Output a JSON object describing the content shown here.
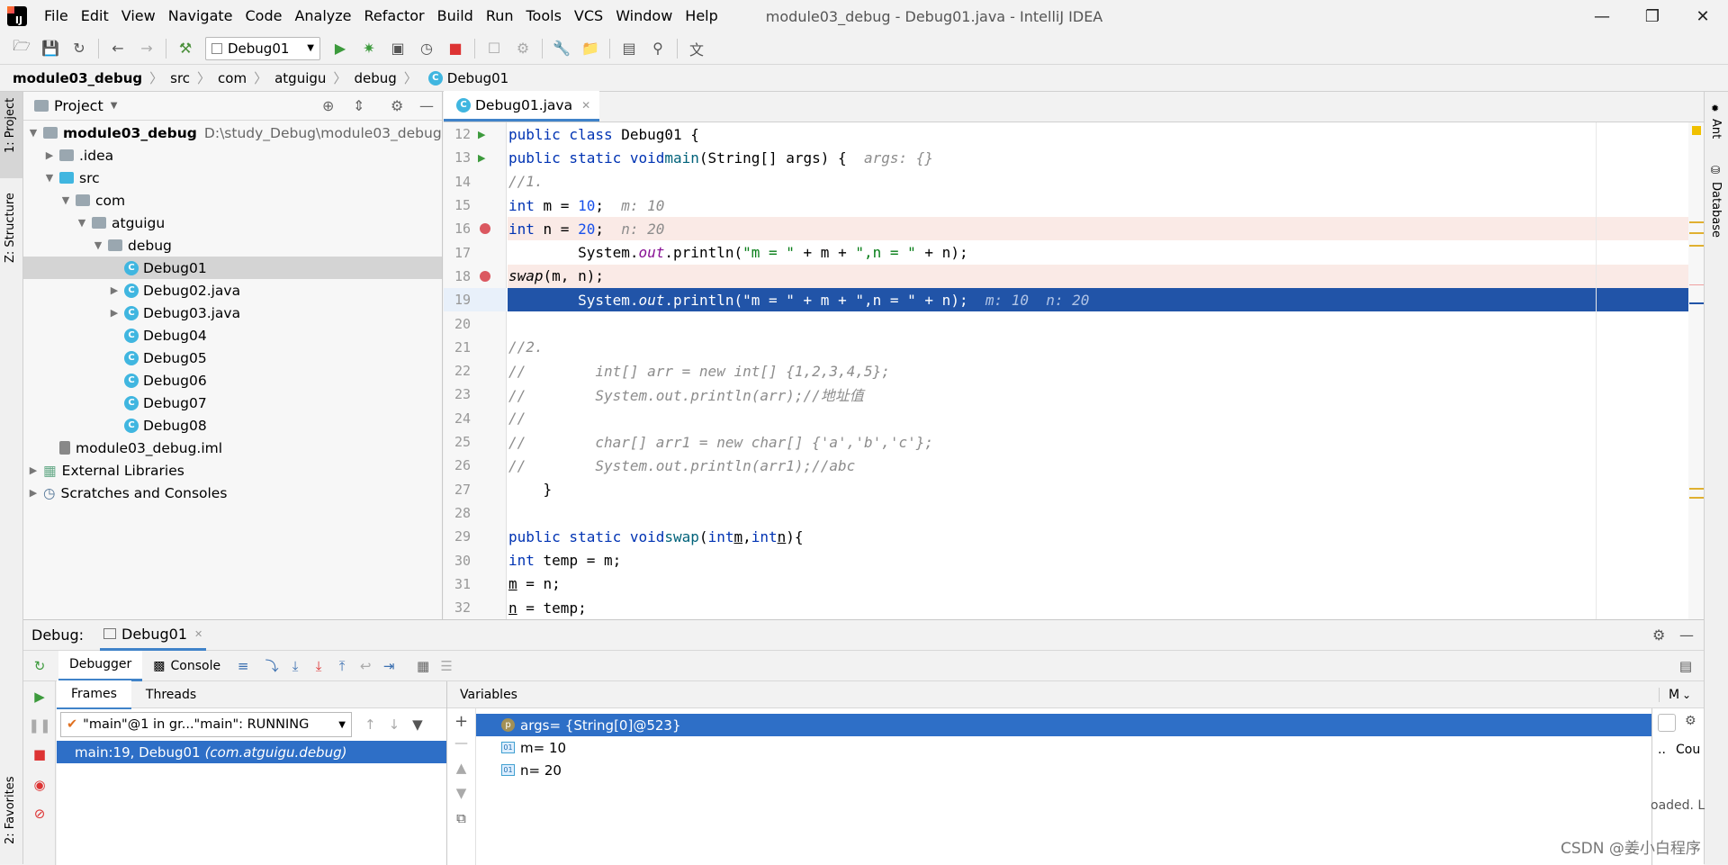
{
  "window": {
    "title": "module03_debug - Debug01.java - IntelliJ IDEA",
    "menu": [
      "File",
      "Edit",
      "View",
      "Navigate",
      "Code",
      "Analyze",
      "Refactor",
      "Build",
      "Run",
      "Tools",
      "VCS",
      "Window",
      "Help"
    ],
    "logo_text": "IJ"
  },
  "toolbar": {
    "run_config": "Debug01"
  },
  "breadcrumb": [
    "module03_debug",
    "src",
    "com",
    "atguigu",
    "debug",
    "Debug01"
  ],
  "left_stripe": {
    "project": "1: Project",
    "structure": "Z: Structure",
    "favorites": "2: Favorites"
  },
  "right_stripe": {
    "ant": "Ant",
    "database": "Database"
  },
  "project": {
    "header": "Project",
    "tree": [
      {
        "label": "module03_debug",
        "hint": "D:\\study_Debug\\module03_debug"
      },
      {
        "label": ".idea"
      },
      {
        "label": "src"
      },
      {
        "label": "com"
      },
      {
        "label": "atguigu"
      },
      {
        "label": "debug"
      },
      {
        "label": "Debug01"
      },
      {
        "label": "Debug02.java"
      },
      {
        "label": "Debug03.java"
      },
      {
        "label": "Debug04"
      },
      {
        "label": "Debug05"
      },
      {
        "label": "Debug06"
      },
      {
        "label": "Debug07"
      },
      {
        "label": "Debug08"
      },
      {
        "label": "module03_debug.iml"
      },
      {
        "label": "External Libraries"
      },
      {
        "label": "Scratches and Consoles"
      }
    ]
  },
  "editor": {
    "tab": "Debug01.java",
    "line_numbers": [
      "12",
      "13",
      "14",
      "15",
      "16",
      "17",
      "18",
      "19",
      "20",
      "21",
      "22",
      "23",
      "24",
      "25",
      "26",
      "27",
      "28",
      "29",
      "30",
      "31",
      "32"
    ],
    "hints": {
      "args": "args: {}",
      "m": "m: 10",
      "n": "n: 20",
      "mn": "m: 10  n: 20"
    },
    "comments": {
      "c1": "//1.",
      "c2": "//2.",
      "l22": "//        int[] arr = new int[] {1,2,3,4,5};",
      "l23": "//        System.out.println(arr);//地址值",
      "l24": "//",
      "l25": "//        char[] arr1 = new char[] {'a','b','c'};",
      "l26": "//        System.out.println(arr1);//abc"
    }
  },
  "debug": {
    "label": "Debug:",
    "session_tab": "Debug01",
    "tabs": {
      "debugger": "Debugger",
      "console": "Console"
    },
    "subtabs": {
      "frames": "Frames",
      "threads": "Threads"
    },
    "thread_select": "\"main\"@1 in gr...\"main\": RUNNING",
    "frame": {
      "location": "main:19, Debug01",
      "pkg": "(com.atguigu.debug)"
    },
    "variables_header": "Variables",
    "variables": [
      {
        "name": "args",
        "value": " = {String[0]@523}"
      },
      {
        "name": "m",
        "value": " = 10"
      },
      {
        "name": "n",
        "value": " = 20"
      }
    ],
    "right_frag": {
      "m": "M",
      "cou": "Cou",
      "loaded": "oaded. L",
      "dots": ".."
    }
  },
  "watermark": "CSDN @姜小白程序"
}
